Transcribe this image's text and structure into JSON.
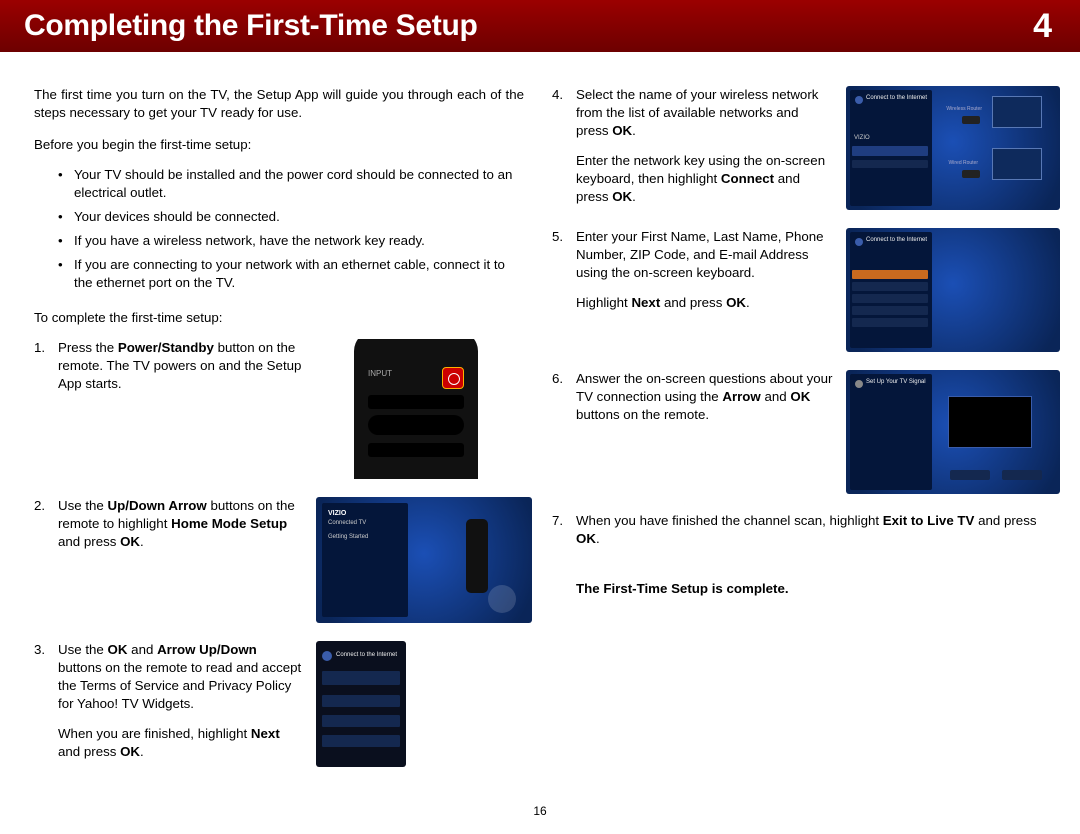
{
  "header": {
    "title": "Completing the First-Time Setup",
    "chapter": "4"
  },
  "intro": "The first time you turn on the TV, the Setup App will guide you through each of the steps necessary to get your TV ready for use.",
  "before_lead": "Before you begin the first-time setup:",
  "before_items": [
    "Your TV should be installed and the power cord should be connected to an electrical outlet.",
    "Your devices should be connected.",
    "If you have a wireless network, have the network key ready.",
    "If you are connecting to your network with an ethernet cable, connect it to the ethernet port on the TV."
  ],
  "complete_lead": "To complete the first-time setup:",
  "steps_left": {
    "s1a": "Press the ",
    "s1b": "Power/Standby",
    "s1c": " button on the remote. The TV powers on and the Setup App starts.",
    "s2a": "Use the ",
    "s2b": "Up/Down Arrow",
    "s2c": " buttons on the remote to highlight ",
    "s2d": "Home Mode Setup",
    "s2e": " and press ",
    "s2f": "OK",
    "s2g": ".",
    "s3a": "Use the ",
    "s3b": "OK",
    "s3c": " and ",
    "s3d": "Arrow Up/Down",
    "s3e": " buttons on the remote to read and accept the Terms of Service and Privacy Policy for Yahoo! TV Widgets.",
    "s3f": "When you are finished, highlight ",
    "s3g": "Next",
    "s3h": " and press ",
    "s3i": "OK",
    "s3j": "."
  },
  "steps_right": {
    "s4a": "Select the name of your wireless network from the list of available networks and press ",
    "s4b": "OK",
    "s4c": ".",
    "s4d": "Enter the network key using the on-screen keyboard, then highlight ",
    "s4e": "Connect",
    "s4f": " and press ",
    "s4g": "OK",
    "s4h": ".",
    "s5a": "Enter your First Name, Last Name, Phone Number, ZIP Code, and E-mail Address using the on-screen keyboard.",
    "s5b": "Highlight ",
    "s5c": "Next",
    "s5d": " and press ",
    "s5e": "OK",
    "s5f": ".",
    "s6a": "Answer the on-screen questions about your TV connection using the ",
    "s6b": "Arrow",
    "s6c": " and ",
    "s6d": "OK",
    "s6e": " buttons on the remote.",
    "s7a": "When you have finished the channel scan, highlight ",
    "s7b": "Exit to Live TV",
    "s7c": " and press ",
    "s7d": "OK",
    "s7e": "."
  },
  "complete_msg": "The First-Time Setup is complete.",
  "page_number": "16",
  "fig_labels": {
    "connected_tv": "Connected TV",
    "getting_started": "Getting Started",
    "connect_internet": "Connect to the Internet",
    "setup_signal": "Set Up Your TV Signal",
    "vizio": "VIZIO",
    "wireless_router": "Wireless Router",
    "wired_router": "Wired Router",
    "input": "INPUT"
  }
}
